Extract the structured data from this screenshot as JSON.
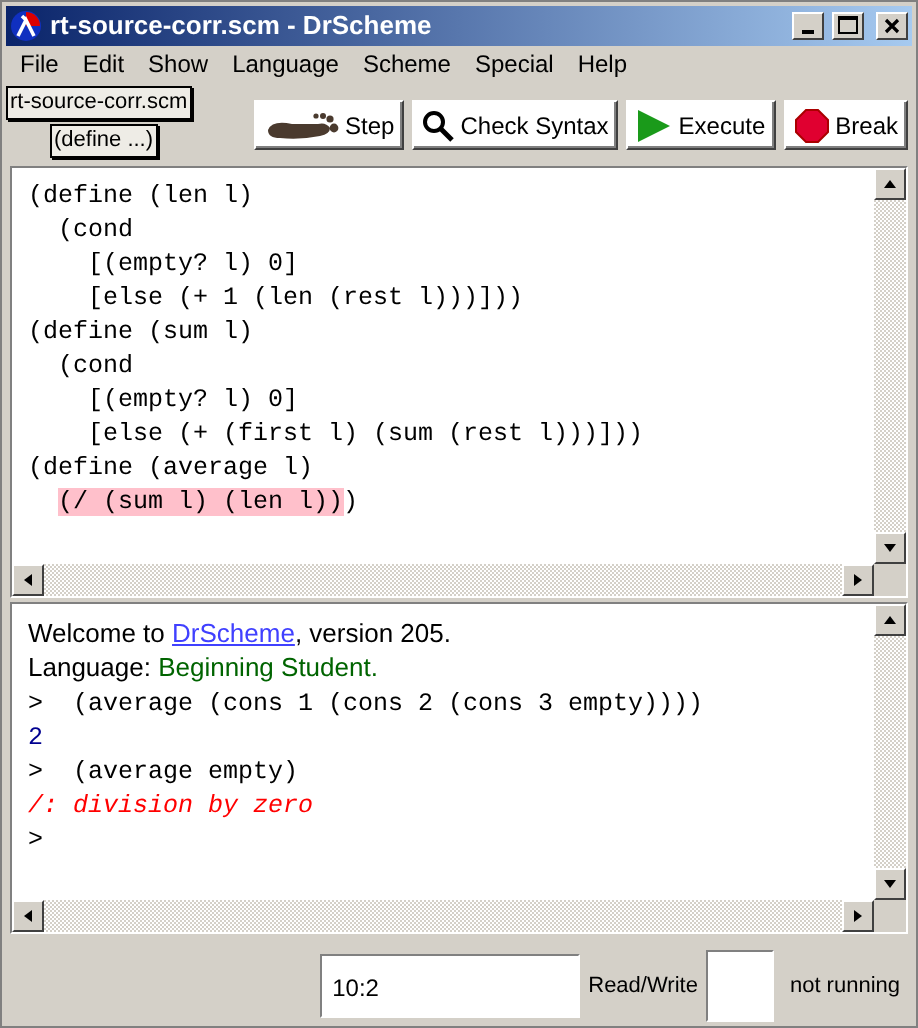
{
  "window": {
    "title": "rt-source-corr.scm - DrScheme"
  },
  "menu": [
    "File",
    "Edit",
    "Show",
    "Language",
    "Scheme",
    "Special",
    "Help"
  ],
  "toolbar": {
    "file_name": "rt-source-corr.scm",
    "definitions_menu": "(define ...)",
    "buttons": [
      {
        "kind": "step",
        "label": "Step"
      },
      {
        "kind": "check",
        "label": "Check Syntax"
      },
      {
        "kind": "execute",
        "label": "Execute"
      },
      {
        "kind": "break",
        "label": "Break"
      }
    ]
  },
  "definitions": [
    [
      {
        "text": "(define (len l)",
        "highlighted": false
      }
    ],
    [
      {
        "text": "  (cond",
        "highlighted": false
      }
    ],
    [
      {
        "text": "    [(empty? l) 0]",
        "highlighted": false
      }
    ],
    [
      {
        "text": "    [else (+ 1 (len (rest l)))]))",
        "highlighted": false
      }
    ],
    [
      {
        "text": "(define (sum l)",
        "highlighted": false
      }
    ],
    [
      {
        "text": "  (cond",
        "highlighted": false
      }
    ],
    [
      {
        "text": "    [(empty? l) 0]",
        "highlighted": false
      }
    ],
    [
      {
        "text": "    [else (+ (first l) (sum (rest l)))]))",
        "highlighted": false
      }
    ],
    [
      {
        "text": "(define (average l)",
        "highlighted": false
      }
    ],
    [
      {
        "text": "  (/ (sum l) (len l))",
        "highlighted": true
      },
      {
        "text": ")",
        "highlighted": false
      }
    ]
  ],
  "interactions": [
    [
      {
        "kind": "text",
        "text": "Welcome to "
      },
      {
        "kind": "link",
        "text": "DrScheme"
      },
      {
        "kind": "text",
        "text": ", version 205."
      }
    ],
    [
      {
        "kind": "text",
        "text": "Language: "
      },
      {
        "kind": "language",
        "text": "Beginning Student."
      }
    ],
    [
      {
        "kind": "input",
        "text": ">  (average (cons 1 (cons 2 (cons 3 empty))))"
      }
    ],
    [
      {
        "kind": "result",
        "text": "2"
      }
    ],
    [
      {
        "kind": "input",
        "text": ">  (average empty)"
      }
    ],
    [
      {
        "kind": "error",
        "text": "/: division by zero"
      }
    ],
    [
      {
        "kind": "input",
        "text": ">"
      }
    ]
  ],
  "status_bar": {
    "position": "10:2",
    "mode": "Read/Write",
    "state": "not running"
  }
}
